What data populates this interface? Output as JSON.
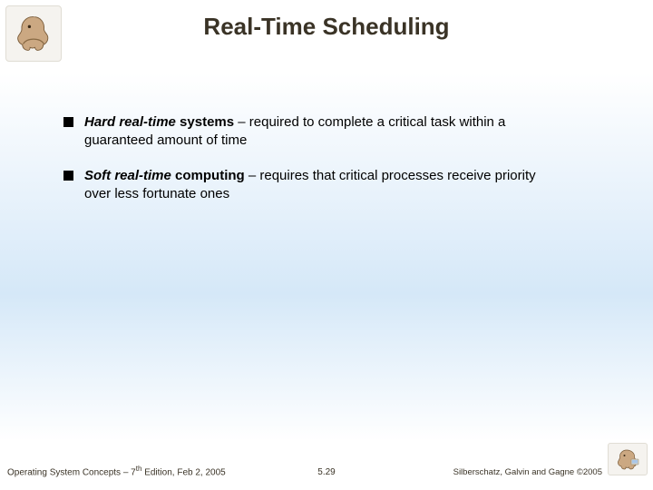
{
  "title": "Real-Time Scheduling",
  "bullets": [
    {
      "lead": "Hard real-time",
      "systems": " systems",
      "rest": " – required to complete a critical task within a guaranteed amount of time"
    },
    {
      "lead": "Soft real-time",
      "systems": " computing",
      "rest": " – requires that critical processes receive priority over less fortunate ones"
    }
  ],
  "footer": {
    "left_prefix": "Operating System Concepts – 7",
    "left_sup": "th",
    "left_suffix": " Edition, Feb 2, 2005",
    "center": "5.29",
    "right": "Silberschatz, Galvin and Gagne ©2005"
  }
}
